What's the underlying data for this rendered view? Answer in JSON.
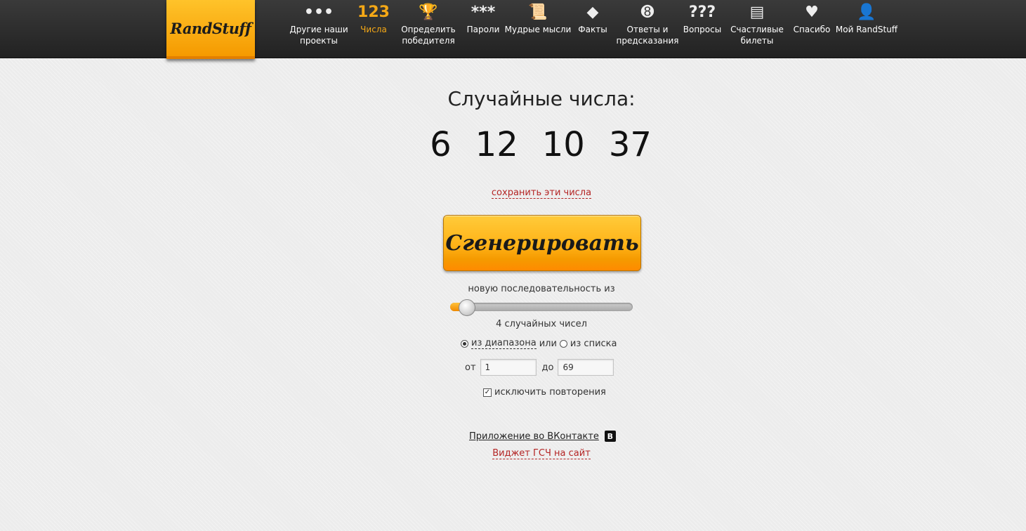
{
  "logo": {
    "text": "RandStuff"
  },
  "nav": [
    {
      "id": "other",
      "icon": "dots-icon",
      "glyph": "•••",
      "label": "Другие наши проекты",
      "active": false
    },
    {
      "id": "numbers",
      "icon": "numbers-icon",
      "glyph": "123",
      "label": "Числа",
      "active": true
    },
    {
      "id": "winner",
      "icon": "trophy-icon",
      "glyph": "🏆",
      "label": "Определить победителя",
      "active": false
    },
    {
      "id": "passwords",
      "icon": "asterisks-icon",
      "glyph": "***",
      "label": "Пароли",
      "active": false
    },
    {
      "id": "thoughts",
      "icon": "scroll-icon",
      "glyph": "📜",
      "label": "Мудрые мысли",
      "active": false
    },
    {
      "id": "facts",
      "icon": "exclamation-diamond-icon",
      "glyph": "◆",
      "label": "Факты",
      "active": false
    },
    {
      "id": "answers",
      "icon": "eight-ball-icon",
      "glyph": "➑",
      "label": "Ответы и предсказания",
      "active": false
    },
    {
      "id": "questions",
      "icon": "question-marks-icon",
      "glyph": "???",
      "label": "Вопросы",
      "active": false
    },
    {
      "id": "tickets",
      "icon": "ticket-icon",
      "glyph": "▤",
      "label": "Счастливые билеты",
      "active": false
    },
    {
      "id": "thanks",
      "icon": "heart-icon",
      "glyph": "♥",
      "label": "Спасибо",
      "active": false
    },
    {
      "id": "my",
      "icon": "user-icon",
      "glyph": "👤",
      "label": "Мой RandStuff",
      "active": false
    }
  ],
  "main": {
    "title": "Случайные числа:",
    "numbers": [
      "6",
      "12",
      "10",
      "37"
    ],
    "save_link": "сохранить эти числа",
    "generate_label": "Сгенерировать",
    "sequence_label": "новую последовательность из",
    "count_value": 4,
    "count_max": 100,
    "count_label": "4 случайных чисел",
    "mode_range_label": "из диапазона",
    "mode_or": "или",
    "mode_list_label": "из списка",
    "from_label": "от",
    "from_value": "1",
    "to_label": "до",
    "to_value": "69",
    "exclude_label": "исключить повторения",
    "exclude_checked": true,
    "vk_link": "Приложение во ВКонтакте",
    "vk_badge": "В",
    "widget_link": "Виджет ГСЧ на сайт"
  },
  "colors": {
    "accent": "#f5a816",
    "link_red": "#b42424"
  }
}
